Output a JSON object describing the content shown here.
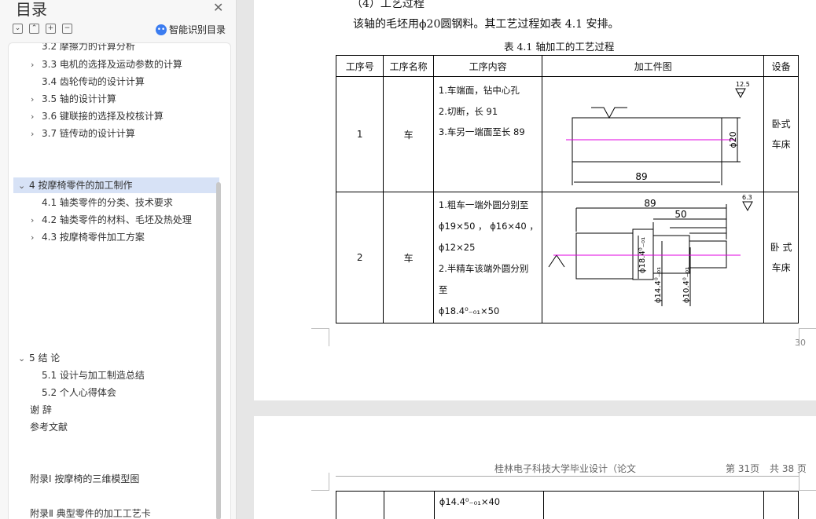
{
  "sidebar": {
    "title": "目录",
    "smart_label": "智能识别目录",
    "tools": [
      "⌄",
      "⌃",
      "+",
      "−"
    ],
    "items": [
      {
        "label": "3.2  摩擦力的计算分析",
        "chev": ""
      },
      {
        "label": "3.3  电机的选择及运动参数的计算",
        "chev": "›"
      },
      {
        "label": "3.4  齿轮传动的设计计算",
        "chev": ""
      },
      {
        "label": "3.5  轴的设计计算",
        "chev": "›"
      },
      {
        "label": "3.6  键联接的选择及校核计算",
        "chev": "›"
      },
      {
        "label": "3.7  链传动的设计计算",
        "chev": "›"
      },
      {
        "label": "4   按摩椅零件的加工制作",
        "chev": "⌄"
      },
      {
        "label": "4.1  轴类零件的分类、技术要求",
        "chev": ""
      },
      {
        "label": "4.2  轴类零件的材料、毛坯及热处理",
        "chev": "›"
      },
      {
        "label": "4.3  按摩椅零件加工方案",
        "chev": "›"
      },
      {
        "label": "5   结   论",
        "chev": "⌄"
      },
      {
        "label": "5.1  设计与加工制造总结",
        "chev": ""
      },
      {
        "label": "5.2  个人心得体会",
        "chev": ""
      },
      {
        "label": "谢   辞",
        "chev": ""
      },
      {
        "label": "参考文献",
        "chev": ""
      },
      {
        "label": "附录Ⅰ  按摩椅的三维模型图",
        "chev": ""
      },
      {
        "label": "附录Ⅱ  典型零件的加工工艺卡",
        "chev": ""
      }
    ]
  },
  "document": {
    "heading": "（4）工艺过程",
    "paragraph": "该轴的毛坯用ϕ20圆钢料。其工艺过程如表 4.1 安排。",
    "table_caption": "表 4.1  轴加工的工艺过程",
    "headers": [
      "工序号",
      "工序名称",
      "工序内容",
      "加工件图",
      "设备"
    ],
    "rows": [
      {
        "no": "1",
        "name": "车",
        "content": [
          "1.车端面，钻中心孔",
          "2.切断，长 91",
          "3.车另一端面至长 89"
        ],
        "device": [
          "卧式",
          "车床"
        ]
      },
      {
        "no": "2",
        "name": "车",
        "content": [
          "1.粗车一端外圆分别至",
          "ϕ19×50 ， ϕ16×40 ，",
          "ϕ12×25",
          "2.半精车该端外圆分别",
          "至",
          "ϕ18.4⁰₋₀₁×50"
        ],
        "device": [
          "卧 式",
          "车床"
        ]
      }
    ],
    "page_number": "30",
    "header2": {
      "left": "桂林电子科技大学毕业设计（论文",
      "page": "第 31页",
      "total": "共 38 页"
    },
    "page2_cell": "ϕ14.4⁰₋₀₁×40",
    "drawing1": {
      "roughness": "12.5",
      "dim_len": "89",
      "dim_dia": "ϕ20"
    },
    "drawing2": {
      "roughness": "6.3",
      "dim_89": "89",
      "dim_50": "50",
      "d1": "ϕ18.4⁰₋₀₁",
      "d2": "ϕ14.4⁰₋₀₁",
      "d3": "ϕ10.4⁰₋₀₁"
    }
  }
}
